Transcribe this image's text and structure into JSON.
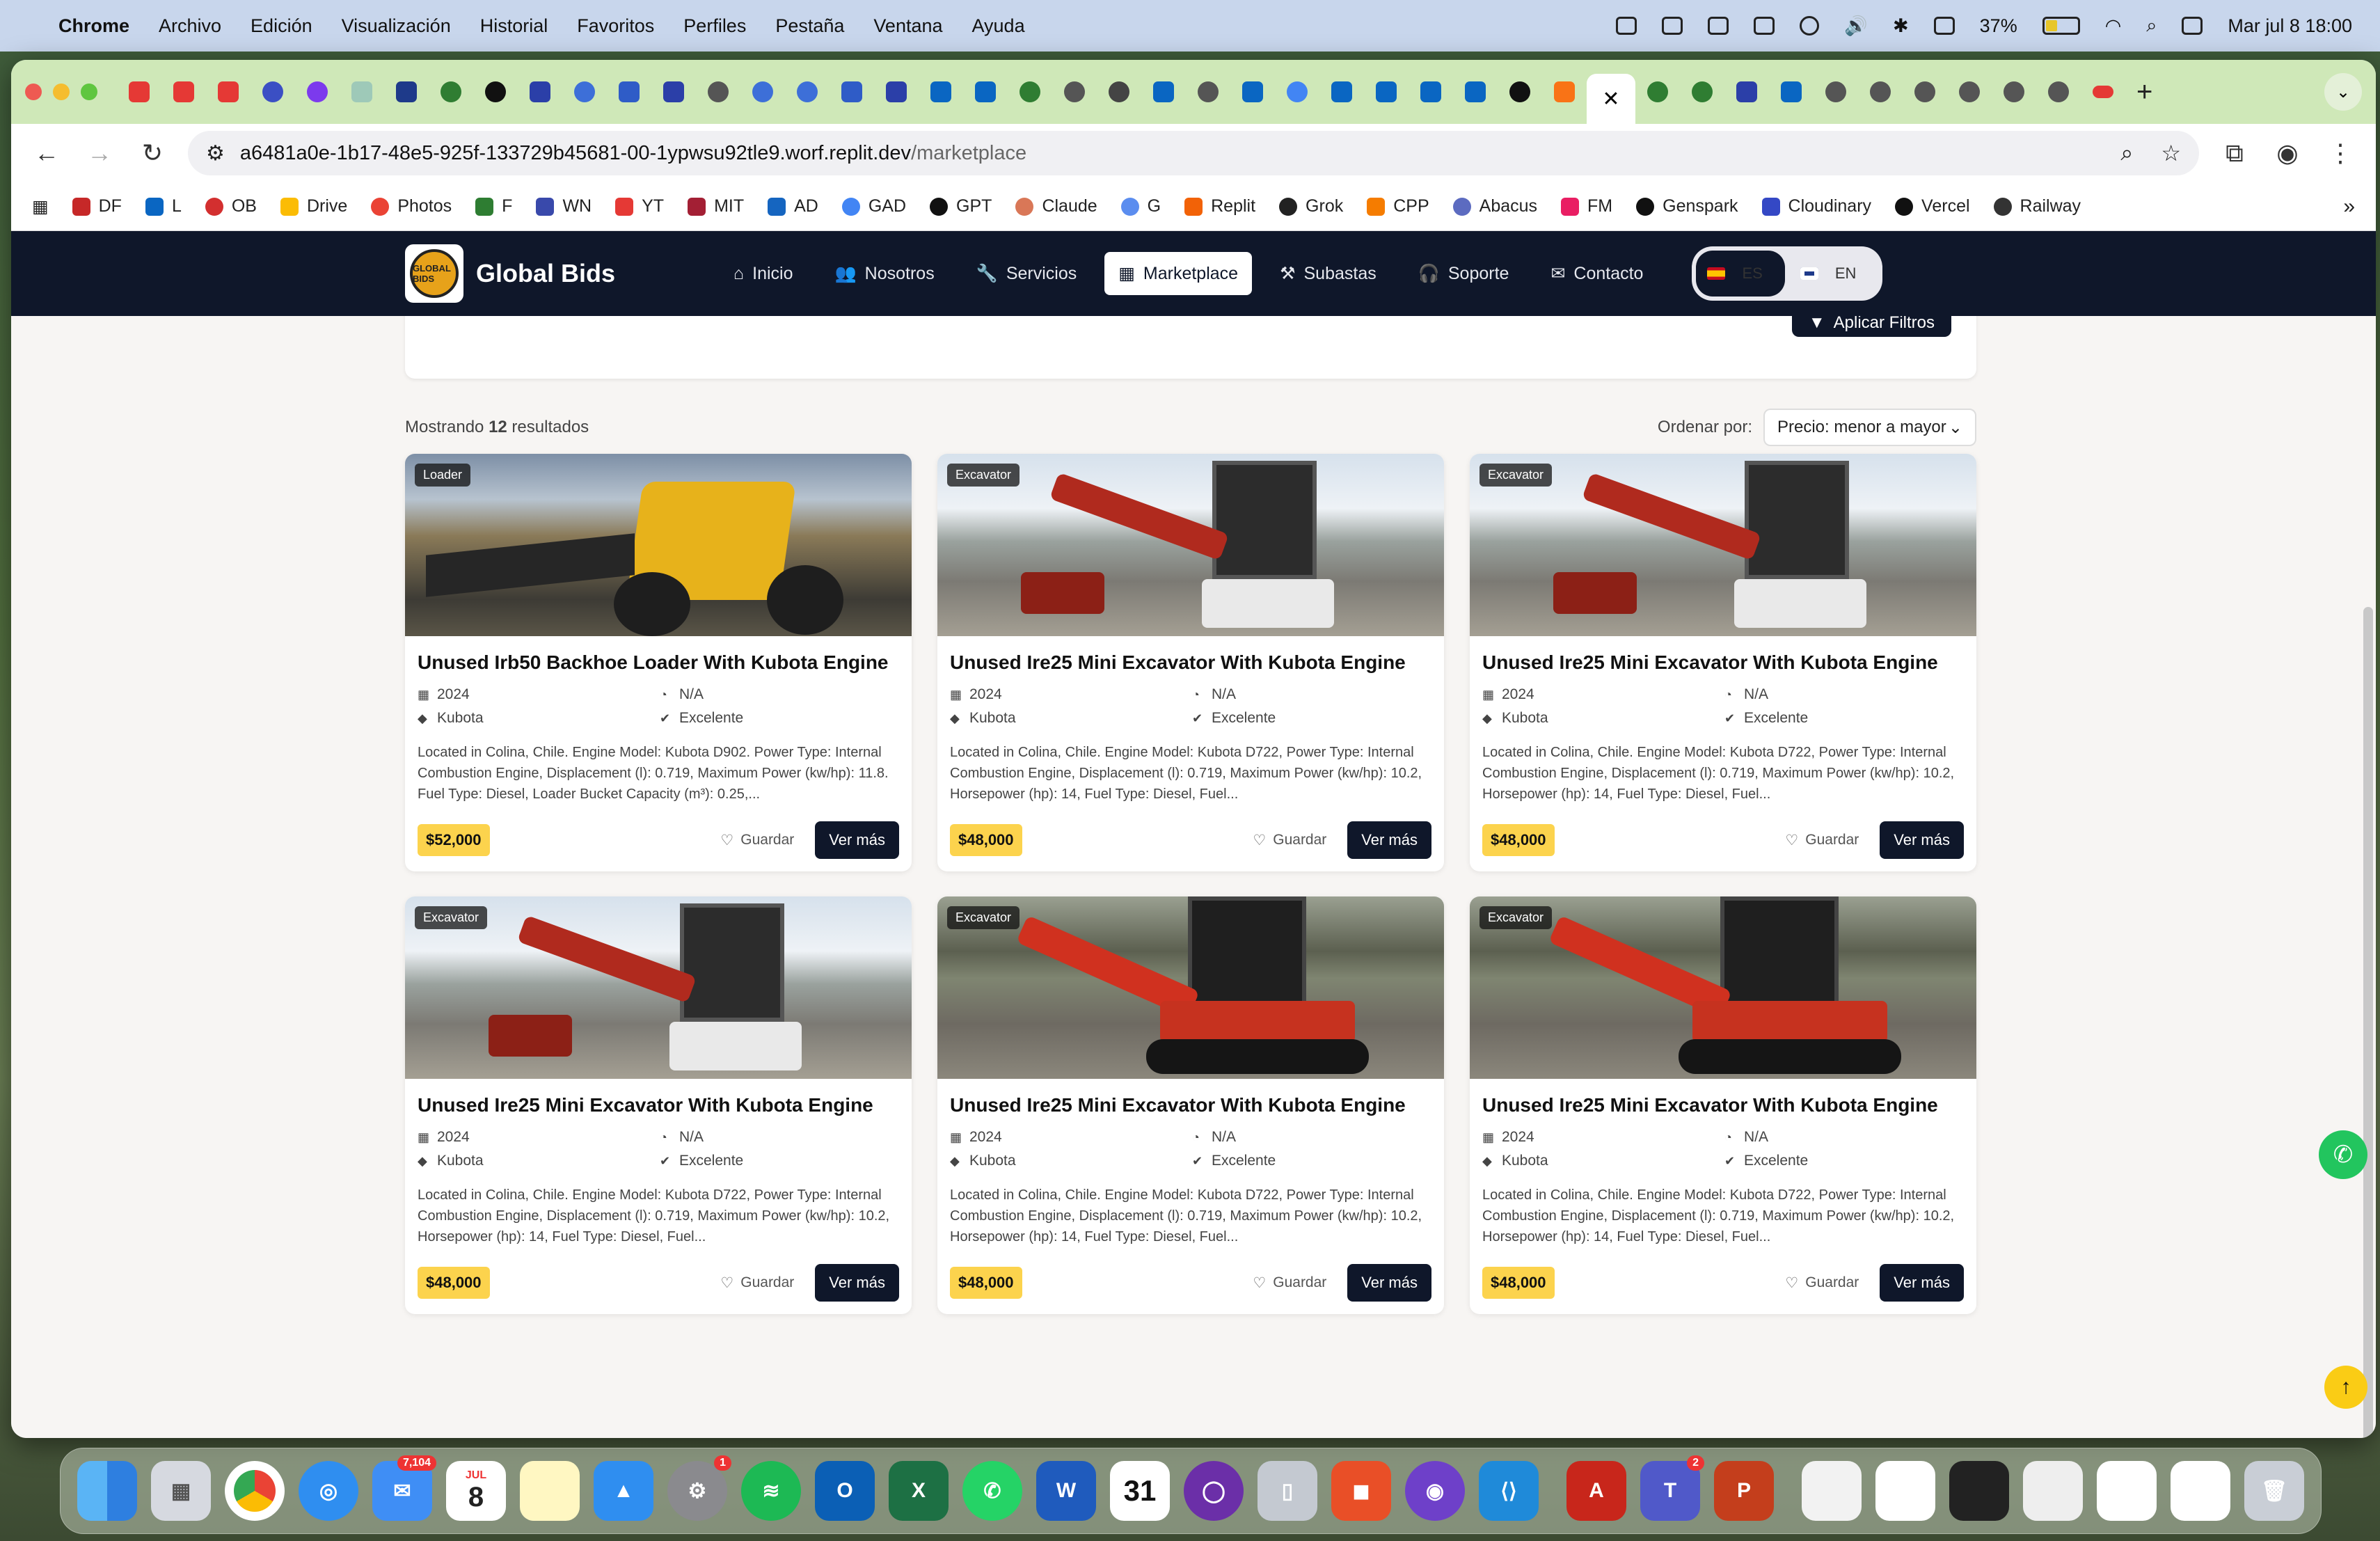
{
  "menubar": {
    "app": "Chrome",
    "items": [
      "Archivo",
      "Edición",
      "Visualización",
      "Historial",
      "Favoritos",
      "Perfiles",
      "Pestaña",
      "Ventana",
      "Ayuda"
    ],
    "battery": "37%",
    "datetime": "Mar jul 8  18:00"
  },
  "browser": {
    "url_host": "a6481a0e-1b17-48e5-925f-133729b45681-00-1ypwsu92tle9.worf.replit.dev",
    "url_path": "/marketplace",
    "bookmarks": [
      "DF",
      "L",
      "OB",
      "Drive",
      "Photos",
      "F",
      "WN",
      "YT",
      "MIT",
      "AD",
      "GAD",
      "GPT",
      "Claude",
      "G",
      "Replit",
      "Grok",
      "CPP",
      "Abacus",
      "FM",
      "Genspark",
      "Cloudinary",
      "Vercel",
      "Railway"
    ]
  },
  "site": {
    "brand": "Global Bids",
    "logo_text": "GLOBAL BIDS",
    "nav": [
      "Inicio",
      "Nosotros",
      "Servicios",
      "Marketplace",
      "Subastas",
      "Soporte",
      "Contacto"
    ],
    "lang_es": "ES",
    "lang_en": "EN",
    "apply_filters": "Aplicar Filtros",
    "results_prefix": "Mostrando ",
    "results_count": "12",
    "results_suffix": " resultados",
    "sort_label": "Ordenar por:",
    "sort_value": "Precio: menor a mayor",
    "save_label": "Guardar",
    "more_label": "Ver más"
  },
  "products": [
    {
      "category": "Loader",
      "title": "Unused Irb50 Backhoe Loader With Kubota Engine",
      "year": "2024",
      "hours": "N/A",
      "brand": "Kubota",
      "condition": "Excelente",
      "description": "Located in Colina, Chile. Engine Model: Kubota D902. Power Type: Internal Combustion Engine, Displacement (l): 0.719, Maximum Power (kw/hp): 11.8. Fuel Type: Diesel, Loader Bucket Capacity (m³): 0.25,...",
      "price": "$52,000"
    },
    {
      "category": "Excavator",
      "title": "Unused Ire25 Mini Excavator With Kubota Engine",
      "year": "2024",
      "hours": "N/A",
      "brand": "Kubota",
      "condition": "Excelente",
      "description": "Located in Colina, Chile. Engine Model: Kubota D722, Power Type: Internal Combustion Engine, Displacement (l): 0.719, Maximum Power (kw/hp): 10.2, Horsepower (hp): 14, Fuel Type: Diesel, Fuel...",
      "price": "$48,000"
    },
    {
      "category": "Excavator",
      "title": "Unused Ire25 Mini Excavator With Kubota Engine",
      "year": "2024",
      "hours": "N/A",
      "brand": "Kubota",
      "condition": "Excelente",
      "description": "Located in Colina, Chile. Engine Model: Kubota D722, Power Type: Internal Combustion Engine, Displacement (l): 0.719, Maximum Power (kw/hp): 10.2, Horsepower (hp): 14, Fuel Type: Diesel, Fuel...",
      "price": "$48,000"
    },
    {
      "category": "Excavator",
      "title": "Unused Ire25 Mini Excavator With Kubota Engine",
      "year": "2024",
      "hours": "N/A",
      "brand": "Kubota",
      "condition": "Excelente",
      "description": "Located in Colina, Chile. Engine Model: Kubota D722, Power Type: Internal Combustion Engine, Displacement (l): 0.719, Maximum Power (kw/hp): 10.2, Horsepower (hp): 14, Fuel Type: Diesel, Fuel...",
      "price": "$48,000"
    },
    {
      "category": "Excavator",
      "title": "Unused Ire25 Mini Excavator With Kubota Engine",
      "year": "2024",
      "hours": "N/A",
      "brand": "Kubota",
      "condition": "Excelente",
      "description": "Located in Colina, Chile. Engine Model: Kubota D722, Power Type: Internal Combustion Engine, Displacement (l): 0.719, Maximum Power (kw/hp): 10.2, Horsepower (hp): 14, Fuel Type: Diesel, Fuel...",
      "price": "$48,000"
    },
    {
      "category": "Excavator",
      "title": "Unused Ire25 Mini Excavator With Kubota Engine",
      "year": "2024",
      "hours": "N/A",
      "brand": "Kubota",
      "condition": "Excelente",
      "description": "Located in Colina, Chile. Engine Model: Kubota D722, Power Type: Internal Combustion Engine, Displacement (l): 0.719, Maximum Power (kw/hp): 10.2, Horsepower (hp): 14, Fuel Type: Diesel, Fuel...",
      "price": "$48,000"
    }
  ],
  "dock": {
    "mail_badge": "7,104",
    "calendar_month": "JUL",
    "calendar_day": "8",
    "settings_badge": "1",
    "teams_badge": "2",
    "cal31": "31"
  },
  "colors": {
    "nav_bg": "#0f172a",
    "price_bg": "#fcd34d",
    "tabstrip": "#cfe8b8",
    "whatsapp": "#22c55e",
    "scroll_top": "#facc15"
  }
}
